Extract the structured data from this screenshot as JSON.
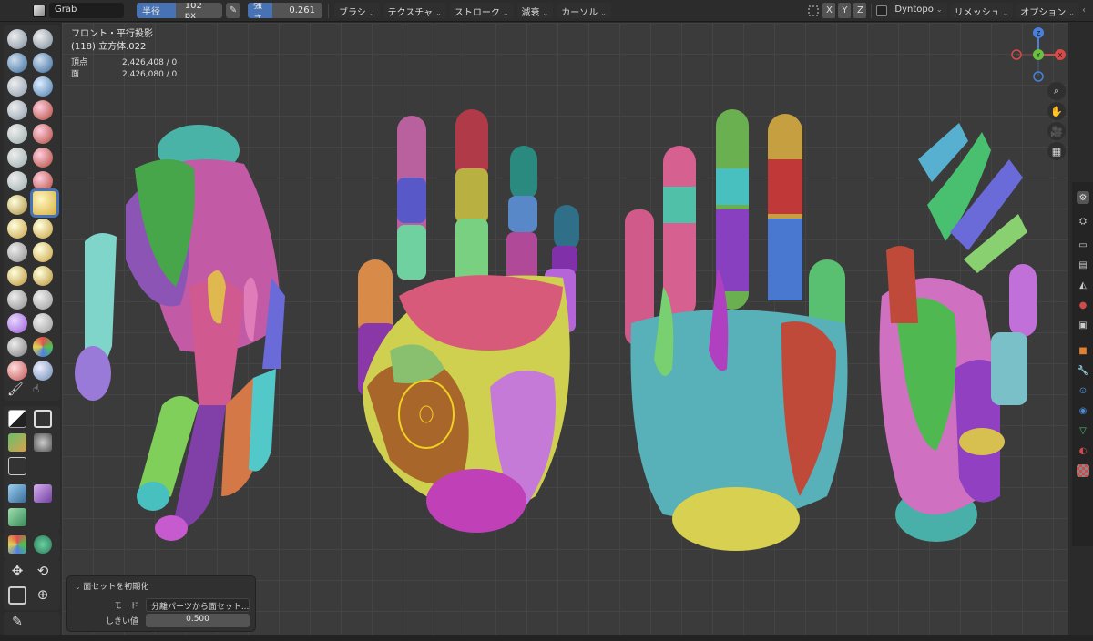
{
  "header": {
    "brush_name": "Grab",
    "radius": {
      "label": "半径",
      "value": "102 px"
    },
    "strength": {
      "label": "強さ",
      "value": "0.261",
      "fraction": 0.261
    },
    "menus": [
      "ブラシ",
      "テクスチャ",
      "ストローク",
      "減衰",
      "カーソル"
    ],
    "axis": [
      "X",
      "Y",
      "Z"
    ],
    "dyntopo": "Dyntopo",
    "remesh": "リメッシュ",
    "options": "オプション"
  },
  "viewport": {
    "view_name": "フロント・平行投影",
    "object_name": "(118) 立方体.022",
    "stats": [
      {
        "key": "頂点",
        "value": "2,426,408 / 0"
      },
      {
        "key": "面",
        "value": "2,426,080 / 0"
      }
    ]
  },
  "gizmo": {
    "x": "X",
    "y": "Y",
    "z": "Z"
  },
  "operator_panel": {
    "title": "面セットを初期化",
    "mode_label": "モード",
    "mode_value": "分離パーツから面セット...",
    "threshold_label": "しきい値",
    "threshold_value": "0.500"
  },
  "colors": {
    "accent": "#4772b3",
    "brush_circle": "#f0d020"
  },
  "icons": {
    "zoom": "magnifier-icon",
    "pan": "hand-icon",
    "camera": "camera-icon",
    "grid": "grid-icon"
  }
}
